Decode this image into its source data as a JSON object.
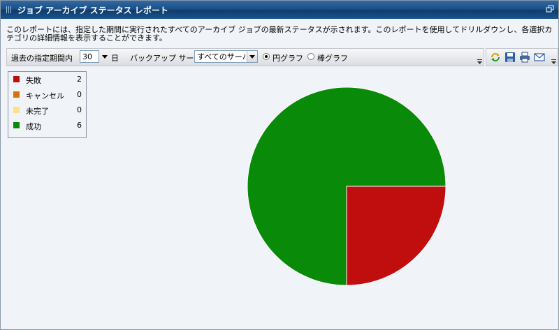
{
  "window": {
    "title": "ジョブ アーカイブ ステータス レポート"
  },
  "description": "このレポートには、指定した期間に実行されたすべてのアーカイブ ジョブの最新ステータスが示されます。このレポートを使用してドリルダウンし、各選択カテゴリの詳細情報を表示することができます。",
  "toolbar": {
    "period_label": "過去の指定期間内",
    "period_value": "30",
    "period_unit": "日",
    "server_label": "バックアップ サーバ:",
    "server_value": "すべてのサーバ",
    "pie_label": "円グラフ",
    "bar_label": "棒グラフ",
    "selected_chart": "pie"
  },
  "tools": [
    "refresh-icon",
    "save-icon",
    "print-icon",
    "email-icon"
  ],
  "legend": [
    {
      "label": "失敗",
      "value": "2",
      "color": "#c00d0d"
    },
    {
      "label": "キャンセル",
      "value": "0",
      "color": "#d9700e"
    },
    {
      "label": "未完了",
      "value": "0",
      "color": "#ffe08a"
    },
    {
      "label": "成功",
      "value": "6",
      "color": "#098a09"
    }
  ],
  "chart_data": {
    "type": "pie",
    "categories": [
      "失敗",
      "キャンセル",
      "未完了",
      "成功"
    ],
    "values": [
      2,
      0,
      0,
      6
    ],
    "colors": [
      "#c00d0d",
      "#d9700e",
      "#ffe08a",
      "#098a09"
    ]
  }
}
